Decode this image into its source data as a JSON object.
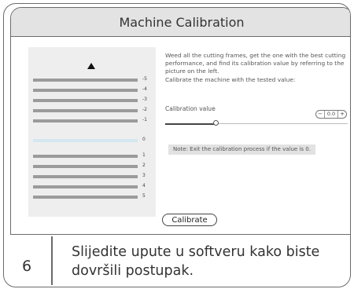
{
  "window": {
    "title": "Machine Calibration"
  },
  "preview": {
    "frames": [
      {
        "label": "-5",
        "highlight": false
      },
      {
        "label": "-4",
        "highlight": false
      },
      {
        "label": "-3",
        "highlight": false
      },
      {
        "label": "-2",
        "highlight": false
      },
      {
        "label": "-1",
        "highlight": false
      },
      {
        "label": "0",
        "highlight": true
      },
      {
        "label": "1",
        "highlight": false
      },
      {
        "label": "2",
        "highlight": false
      },
      {
        "label": "3",
        "highlight": false
      },
      {
        "label": "4",
        "highlight": false
      },
      {
        "label": "5",
        "highlight": false
      }
    ]
  },
  "instructions": {
    "text": "Weed all the cutting frames, get the one with the best cutting performance, and find its calibration value by referring to the picture on the left.\nCalibrate the machine with the tested value:"
  },
  "calibration": {
    "label": "Calibration value",
    "value": "0.0",
    "minus": "−",
    "plus": "+",
    "slider_fraction": 0.28
  },
  "note": "Note: Exit the calibration process if the value is 0.",
  "calibrate_button": "Calibrate",
  "step": {
    "number": "6",
    "text": "Slijedite upute u softveru kako biste dovršili postupak."
  }
}
